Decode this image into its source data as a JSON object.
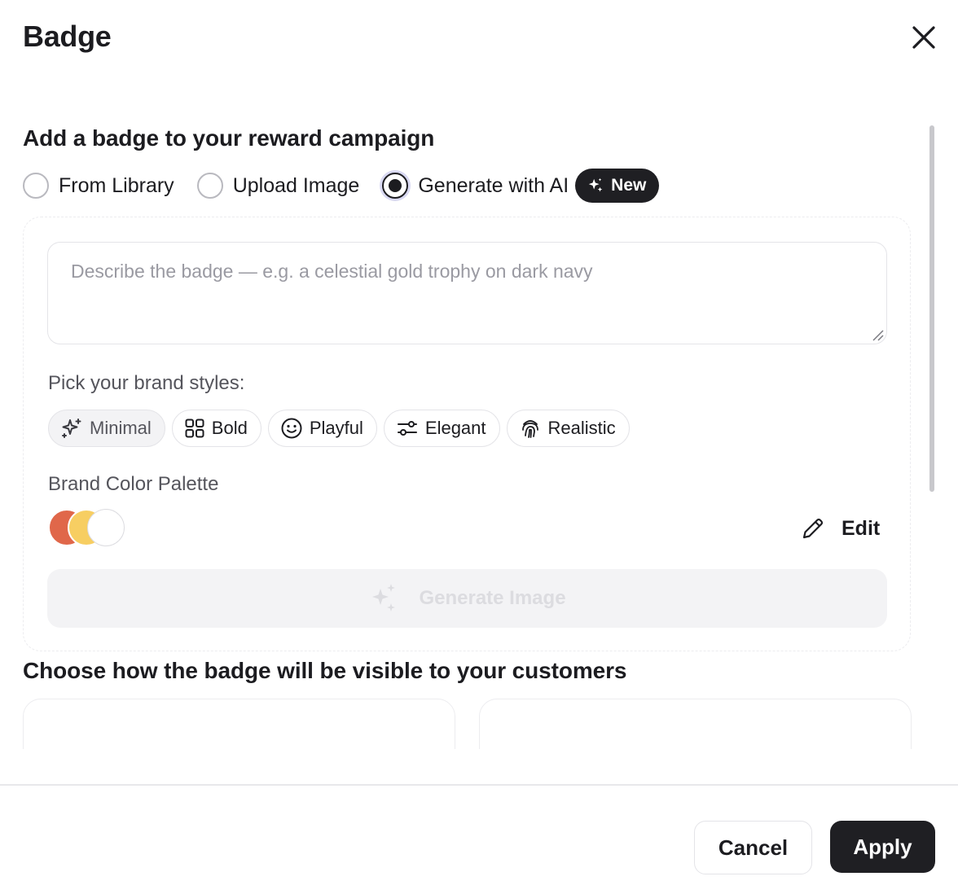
{
  "header": {
    "title": "Badge",
    "close_icon": "close-icon"
  },
  "add_badge": {
    "title": "Add a badge to your reward campaign",
    "options": [
      {
        "label": "From Library",
        "checked": false
      },
      {
        "label": "Upload Image",
        "checked": false
      },
      {
        "label": "Generate with AI",
        "checked": true
      }
    ],
    "new_badge_label": "New",
    "new_badge_icon": "sparkle-icon"
  },
  "ai_panel": {
    "prompt_value": "",
    "prompt_placeholder": "Describe the badge — e.g. a celestial gold trophy on dark navy",
    "styles_label": "Pick your brand styles:",
    "styles": [
      {
        "label": "Minimal",
        "icon": "sparkle-icon",
        "selected": true
      },
      {
        "label": "Bold",
        "icon": "grid-icon",
        "selected": false
      },
      {
        "label": "Playful",
        "icon": "smiley-icon",
        "selected": false
      },
      {
        "label": "Elegant",
        "icon": "sliders-icon",
        "selected": false
      },
      {
        "label": "Realistic",
        "icon": "fingerprint-icon",
        "selected": false
      }
    ],
    "palette_label": "Brand Color Palette",
    "palette_colors": [
      "#e0674a",
      "#f7ce62",
      "#ffffff"
    ],
    "edit_label": "Edit",
    "edit_icon": "pencil-icon",
    "generate_label": "Generate Image",
    "generate_icon": "sparkle-icon"
  },
  "visibility": {
    "title": "Choose how the badge will be visible to your customers"
  },
  "footer": {
    "cancel_label": "Cancel",
    "apply_label": "Apply"
  },
  "colors": {
    "primary": "#1f1f23",
    "border": "#e4e4e8",
    "muted_text": "#9a9aa2",
    "focus_ring": "#d9d9f2"
  }
}
